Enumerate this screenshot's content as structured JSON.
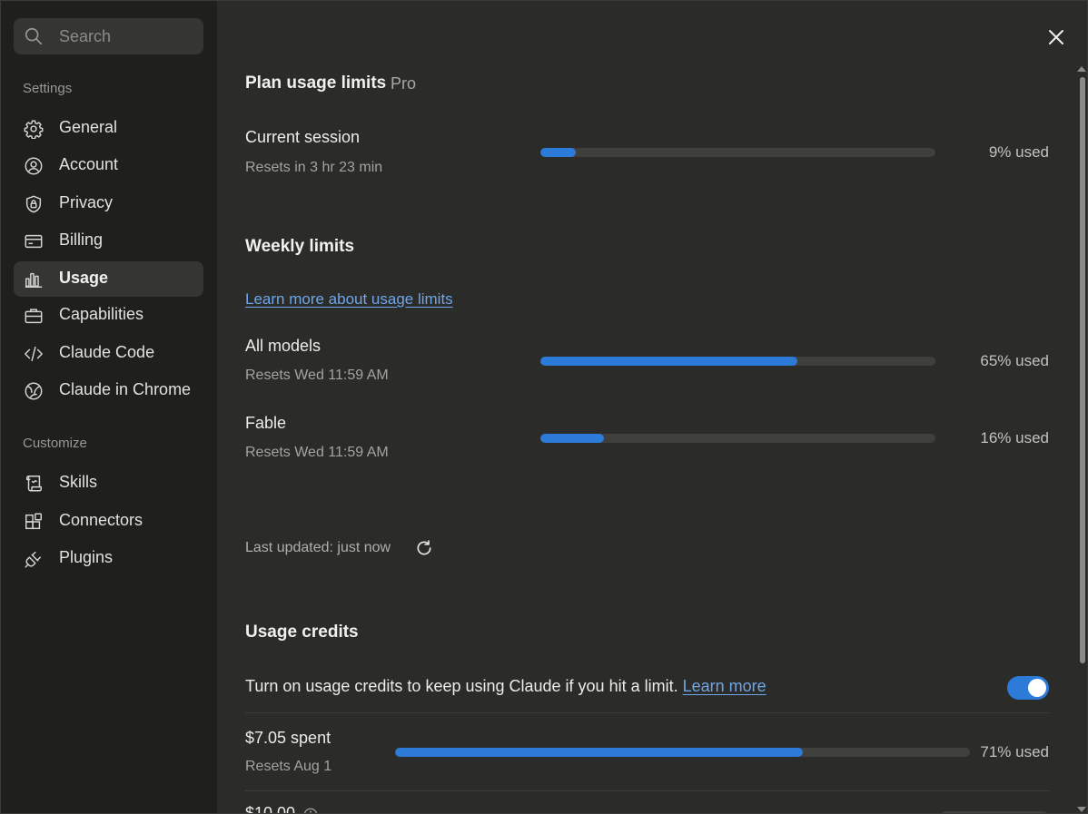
{
  "sidebar": {
    "search_placeholder": "Search",
    "settings_label": "Settings",
    "settings_items": [
      {
        "label": "General",
        "icon": "gear-icon"
      },
      {
        "label": "Account",
        "icon": "user-circle-icon"
      },
      {
        "label": "Privacy",
        "icon": "shield-lock-icon"
      },
      {
        "label": "Billing",
        "icon": "credit-card-icon"
      },
      {
        "label": "Usage",
        "icon": "bar-chart-icon",
        "active": true
      },
      {
        "label": "Capabilities",
        "icon": "briefcase-icon"
      },
      {
        "label": "Claude Code",
        "icon": "code-icon"
      },
      {
        "label": "Claude in Chrome",
        "icon": "globe-icon"
      }
    ],
    "customize_label": "Customize",
    "customize_items": [
      {
        "label": "Skills",
        "icon": "scroll-icon"
      },
      {
        "label": "Connectors",
        "icon": "blocks-icon"
      },
      {
        "label": "Plugins",
        "icon": "plug-icon"
      }
    ]
  },
  "main": {
    "plan_title": "Plan usage limits",
    "plan_badge": "Pro",
    "current_session": {
      "title": "Current session",
      "reset": "Resets in 3 hr 23 min",
      "percent": 9,
      "label": "9% used"
    },
    "weekly_title": "Weekly limits",
    "learn_more_usage": "Learn more about usage limits",
    "all_models": {
      "title": "All models",
      "reset": "Resets Wed 11:59 AM",
      "percent": 65,
      "label": "65% used"
    },
    "fable": {
      "title": "Fable",
      "reset": "Resets Wed 11:59 AM",
      "percent": 16,
      "label": "16% used"
    },
    "last_updated": "Last updated: just now",
    "credits_title": "Usage credits",
    "credits_text": "Turn on usage credits to keep using Claude if you hit a limit.",
    "credits_learn_more": "Learn more",
    "credits_toggle_on": true,
    "spent": {
      "title": "$7.05 spent",
      "reset": "Resets Aug 1",
      "percent": 71,
      "label": "71% used"
    },
    "next_row_title": "$10.00"
  },
  "colors": {
    "accent": "#2c7bd9",
    "link": "#6ea6e8",
    "sidebar_bg": "#1f1f1e",
    "main_bg": "#2b2b2a"
  }
}
